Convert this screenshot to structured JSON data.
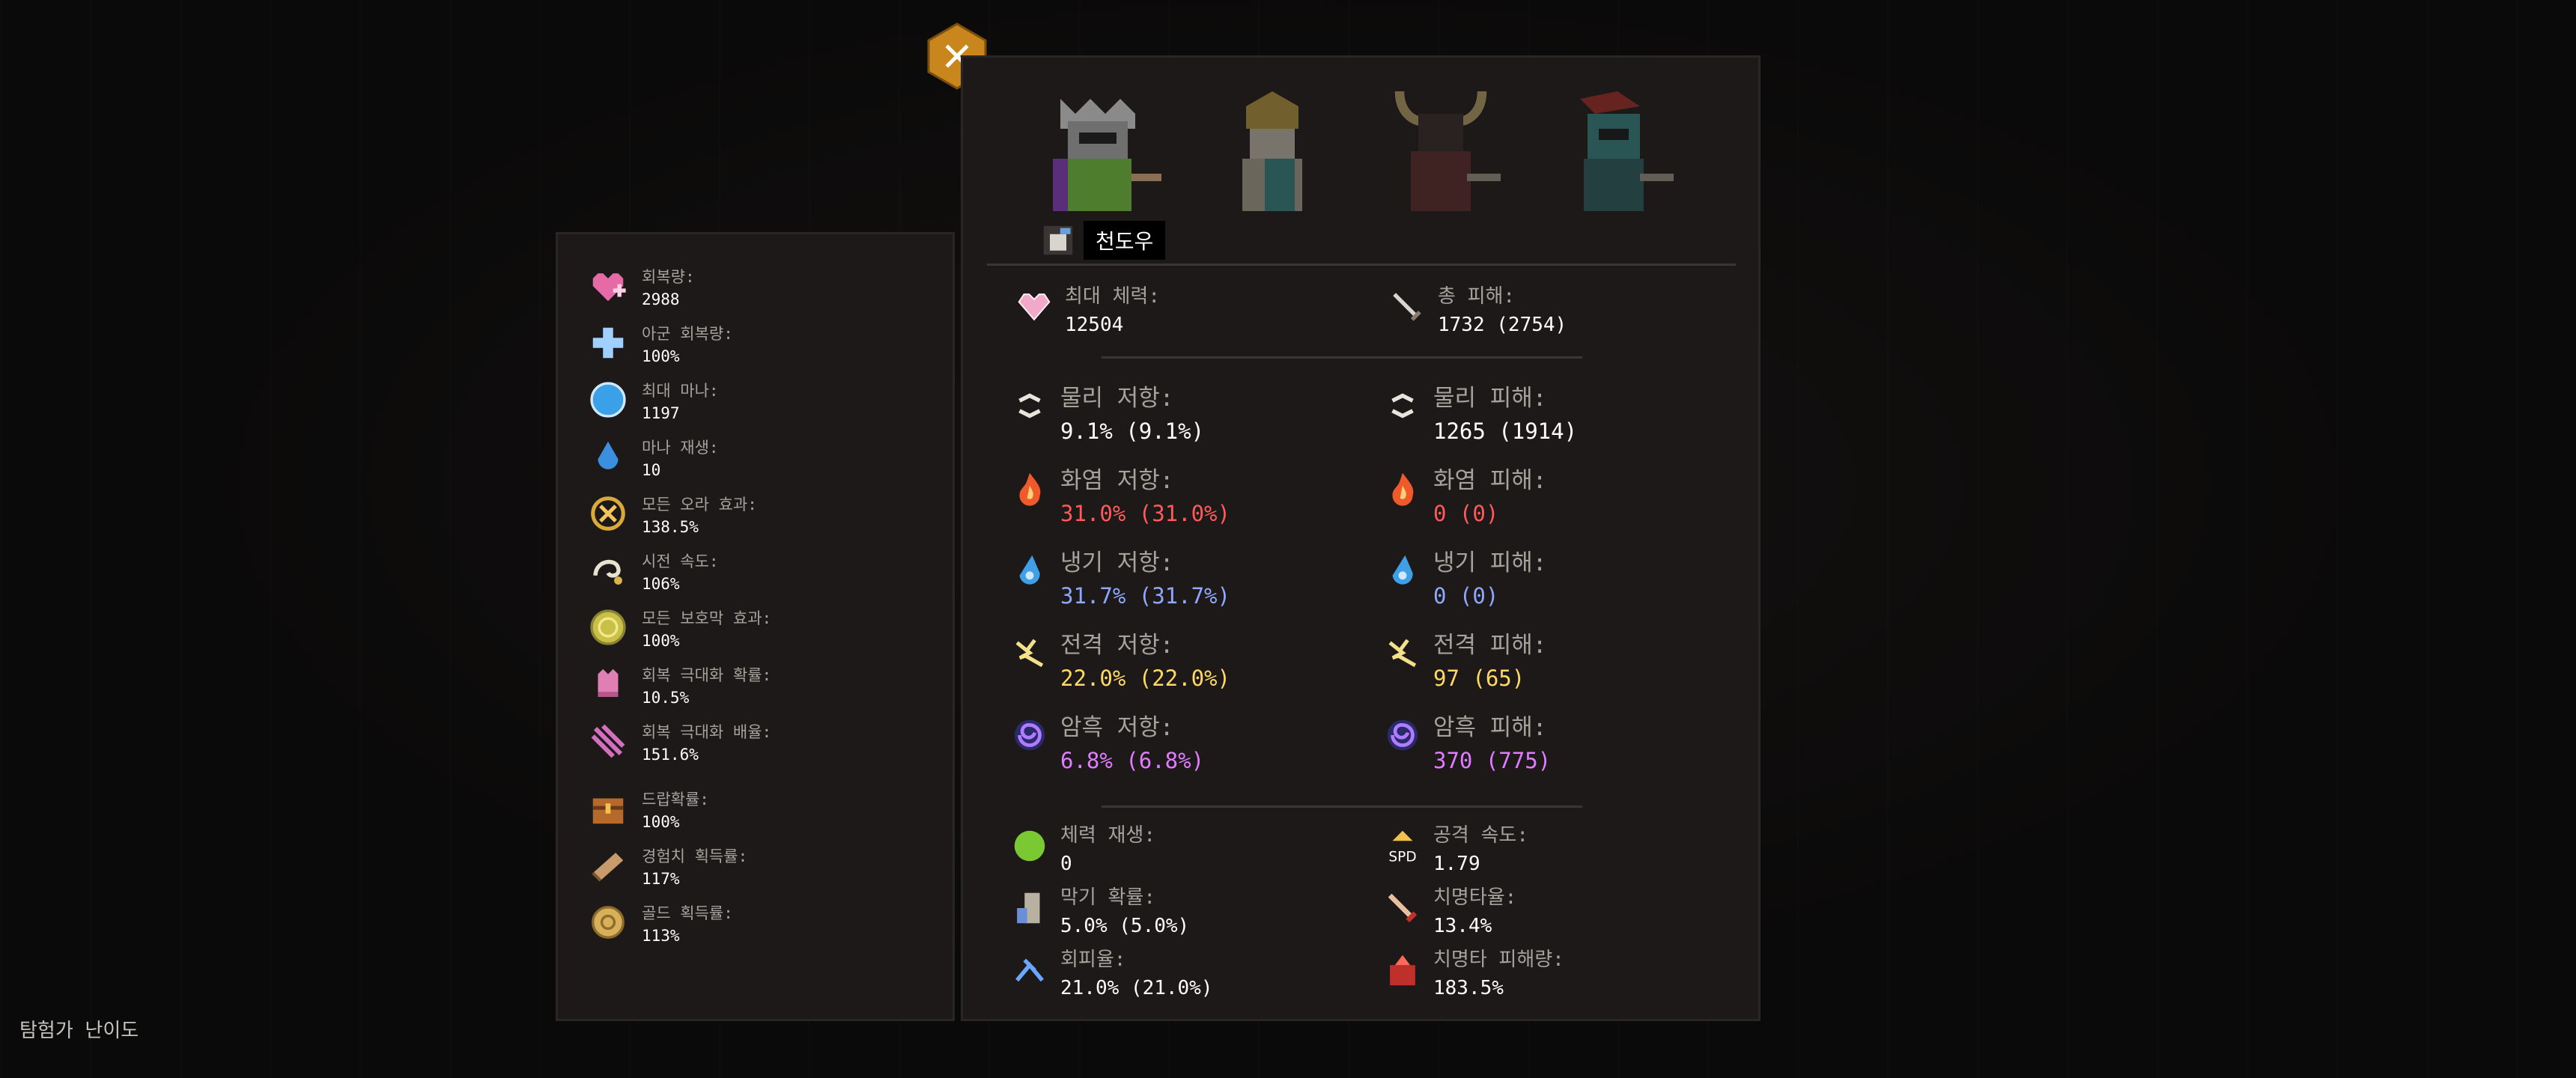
{
  "left_stats": [
    {
      "label": "회복량:",
      "value": "2988",
      "icon": "heart-plus-icon"
    },
    {
      "label": "아군 회복량:",
      "value": "100%",
      "icon": "cross-plus-icon"
    },
    {
      "label": "최대 마나:",
      "value": "1197",
      "icon": "mana-orb-icon"
    },
    {
      "label": "마나 재생:",
      "value": "10",
      "icon": "water-drop-icon"
    },
    {
      "label": "모든 오라 효과:",
      "value": "138.5%",
      "icon": "aura-icon"
    },
    {
      "label": "시전 속도:",
      "value": "106%",
      "icon": "cast-speed-icon"
    },
    {
      "label": "모든 보호막 효과:",
      "value": "100%",
      "icon": "shield-orb-icon"
    },
    {
      "label": "회복 극대화 확률:",
      "value": "10.5%",
      "icon": "heal-crit-chance-icon"
    },
    {
      "label": "회복 극대화 배율:",
      "value": "151.6%",
      "icon": "heal-crit-multiplier-icon"
    },
    {
      "label": "드랍확률:",
      "value": "100%",
      "icon": "chest-icon"
    },
    {
      "label": "경험치 획득률:",
      "value": "117%",
      "icon": "book-icon"
    },
    {
      "label": "골드 획득률:",
      "value": "113%",
      "icon": "gold-coin-icon"
    }
  ],
  "character_name": "천도우",
  "top_stats": {
    "max_hp": {
      "label": "최대 체력:",
      "value": "12504"
    },
    "total_damage": {
      "label": "총 피해:",
      "value": "1732 (2754)"
    }
  },
  "elements": [
    {
      "res_label": "물리 저항:",
      "res_value": "9.1% (9.1%)",
      "dmg_label": "물리 피해:",
      "dmg_value": "1265 (1914)",
      "icon": "physical-icon",
      "color_class": ""
    },
    {
      "res_label": "화염 저항:",
      "res_value": "31.0% (31.0%)",
      "dmg_label": "화염 피해:",
      "dmg_value": "0 (0)",
      "icon": "fire-icon",
      "color_class": "fire"
    },
    {
      "res_label": "냉기 저항:",
      "res_value": "31.7% (31.7%)",
      "dmg_label": "냉기 피해:",
      "dmg_value": "0 (0)",
      "icon": "frost-icon",
      "color_class": "cold"
    },
    {
      "res_label": "전격 저항:",
      "res_value": "22.0% (22.0%)",
      "dmg_label": "전격 피해:",
      "dmg_value": "97 (65)",
      "icon": "lightning-icon",
      "color_class": "light"
    },
    {
      "res_label": "암흑 저항:",
      "res_value": "6.8% (6.8%)",
      "dmg_label": "암흑 피해:",
      "dmg_value": "370 (775)",
      "icon": "dark-vortex-icon",
      "color_class": "dark"
    }
  ],
  "bottom_stats": {
    "hp_regen": {
      "label": "체력 재생:",
      "value": "0"
    },
    "attack_speed": {
      "label": "공격 속도:",
      "value": "1.79",
      "icon_text": "SPD"
    },
    "block": {
      "label": "막기 확률:",
      "value": "5.0% (5.0%)"
    },
    "crit_rate": {
      "label": "치명타율:",
      "value": "13.4%"
    },
    "evasion": {
      "label": "회피율:",
      "value": "21.0% (21.0%)"
    },
    "crit_damage": {
      "label": "치명타 피해량:",
      "value": "183.5%"
    }
  },
  "difficulty_label": "탐험가 난이도",
  "colors": {
    "panel": "#1c1918",
    "close_button": "#c8861c",
    "fire": "#ff5a5a",
    "cold": "#8fa8ff",
    "lightning": "#ffd966",
    "dark": "#e07cff"
  }
}
